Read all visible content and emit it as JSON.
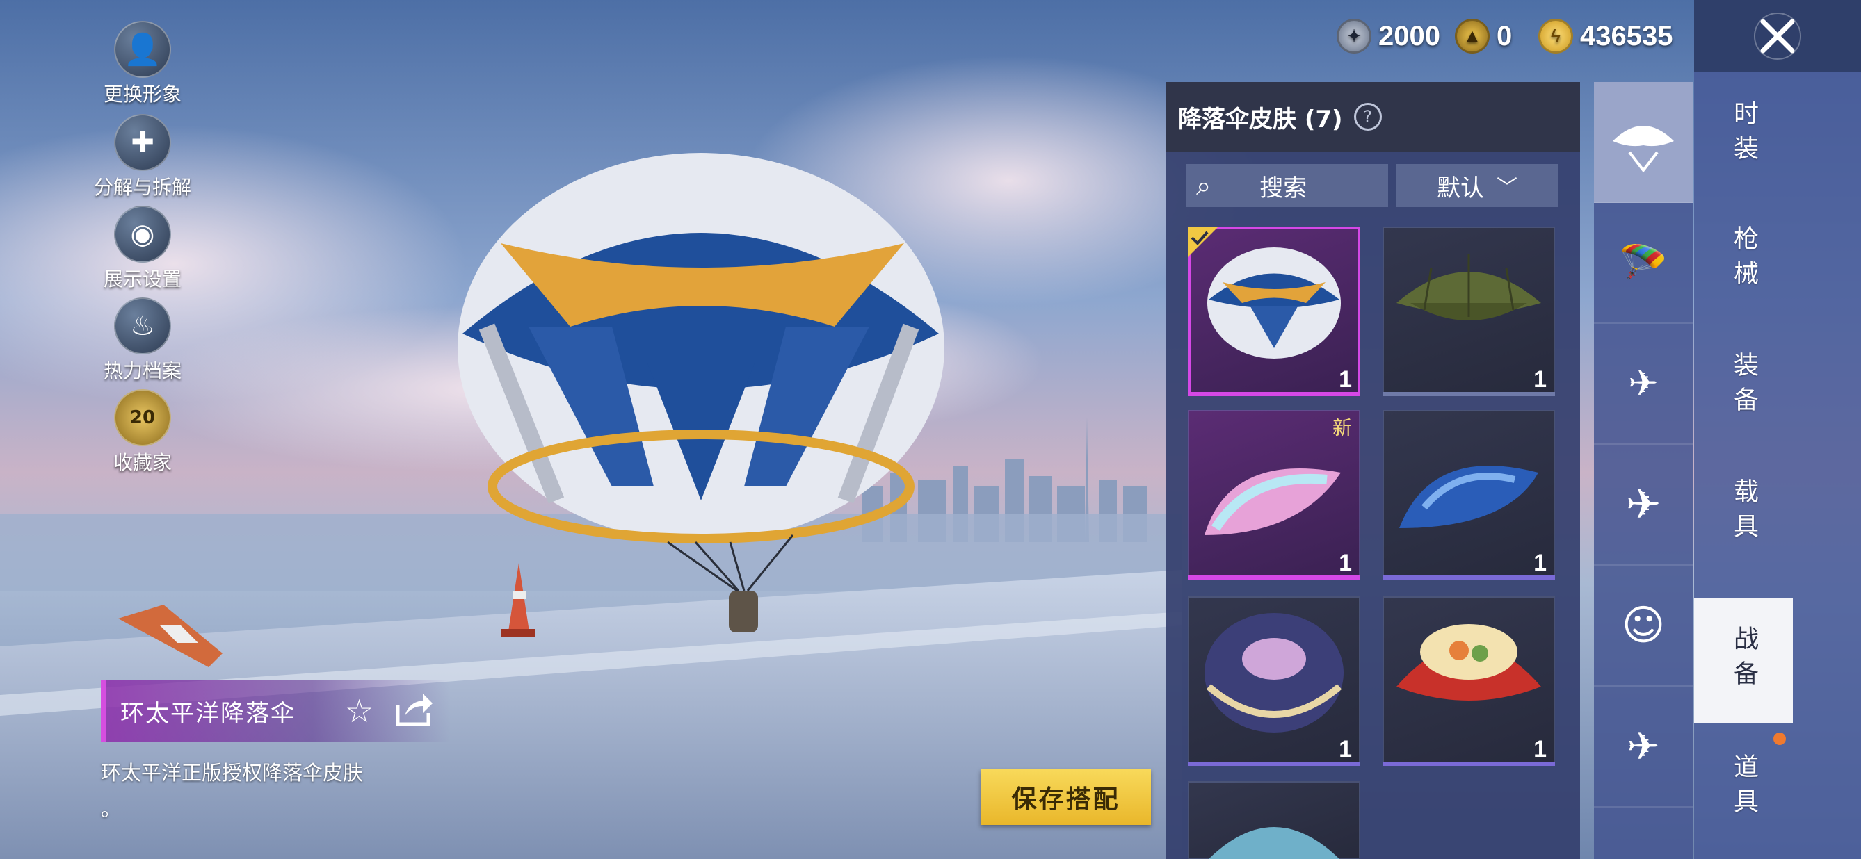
{
  "currencies": [
    {
      "name": "silver-coin",
      "value": "2000"
    },
    {
      "name": "achievement-coin",
      "value": "0"
    },
    {
      "name": "gold-coin",
      "value": "436535"
    }
  ],
  "side_menu": [
    {
      "label": "更换形象",
      "icon": "avatar-icon"
    },
    {
      "label": "分解与拆解",
      "icon": "puzzle-icon"
    },
    {
      "label": "展示设置",
      "icon": "eye-icon"
    },
    {
      "label": "热力档案",
      "icon": "flame-icon"
    },
    {
      "label": "收藏家",
      "icon": "collector-badge-icon",
      "badge": "20"
    }
  ],
  "item": {
    "title": "环太平洋降落伞",
    "description_line1": "环太平洋正版授权降落伞皮肤",
    "description_line2": "。"
  },
  "save_label": "保存搭配",
  "panel": {
    "title": "降落伞皮肤 (7)",
    "search_label": "搜索",
    "sort_label": "默认",
    "cards": [
      {
        "name": "pacific-rim-parachute",
        "count": "1",
        "selected": true,
        "new": false
      },
      {
        "name": "olive-parachute",
        "count": "1",
        "selected": false,
        "new": false
      },
      {
        "name": "pink-marble-parachute",
        "count": "1",
        "selected": false,
        "new": true
      },
      {
        "name": "blue-camo-parachute",
        "count": "1",
        "selected": false,
        "new": false
      },
      {
        "name": "dragon-dome-parachute",
        "count": "1",
        "selected": false,
        "new": false
      },
      {
        "name": "sushi-parachute",
        "count": "1",
        "selected": false,
        "new": false
      }
    ],
    "new_tag": "新"
  },
  "icon_tabs": [
    "parachute-icon",
    "skydiver-icon",
    "drone-icon",
    "plane-icon",
    "emote-icon",
    "glider-icon"
  ],
  "categories": [
    "时装",
    "枪械",
    "装备",
    "载具",
    "战备",
    "道具"
  ],
  "active_category": "战备",
  "colors": {
    "accent": "#d548e6",
    "save": "#f1c843",
    "panel": "#343f6e"
  }
}
